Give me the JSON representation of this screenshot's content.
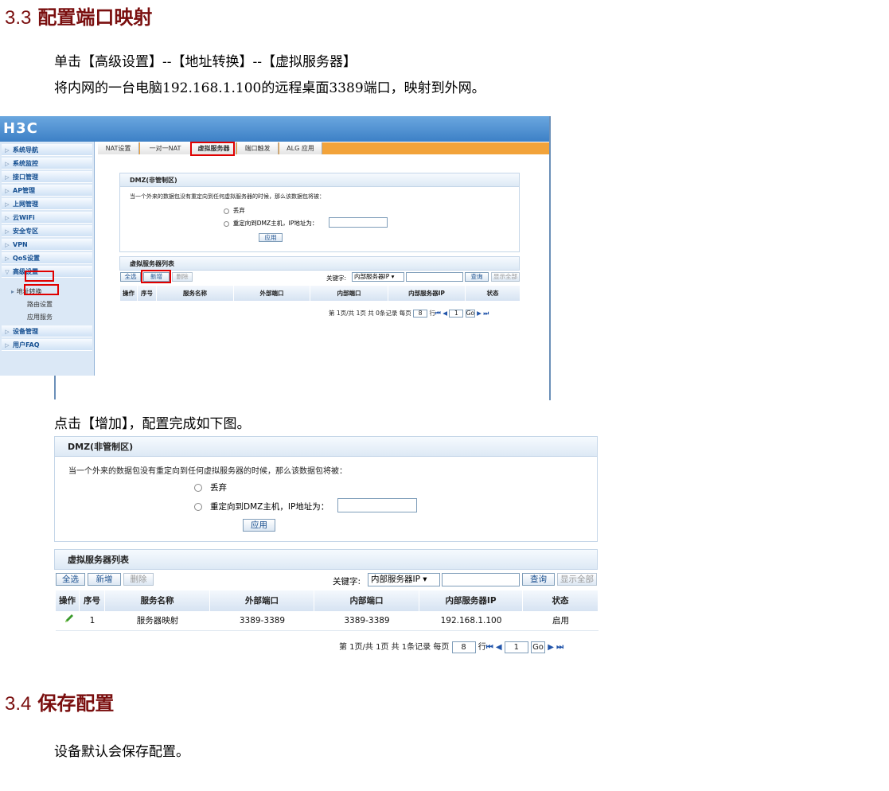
{
  "sections": [
    {
      "number": "3.3",
      "title": "配置端口映射"
    },
    {
      "number": "3.4",
      "title": "保存配置"
    }
  ],
  "paragraphs": {
    "nav_path": "单击【高级设置】--【地址转换】--【虚拟服务器】",
    "intro": "将内网的一台电脑192.168.1.100的远程桌面3389端口，映射到外网。",
    "click_add": "点击【增加】，配置完成如下图。",
    "save_default": "设备默认会保存配置。"
  },
  "router_ui": {
    "logo": "H3C",
    "sidebar": [
      "系统导航",
      "系统监控",
      "接口管理",
      "AP管理",
      "上网管理",
      "云WiFi",
      "安全专区",
      "VPN",
      "QoS设置",
      "高级设置",
      "设备管理",
      "用户FAQ"
    ],
    "sidebar_sub": [
      "地址转换",
      "路由设置",
      "应用服务"
    ],
    "tabs": [
      "NAT设置",
      "一对一NAT",
      "虚拟服务器",
      "端口触发",
      "ALG 应用"
    ],
    "dmz": {
      "title": "DMZ(非管制区)",
      "description": "当一个外来的数据包没有重定向到任何虚拟服务器的时候，那么该数据包将被：",
      "option_drop": "丢弃",
      "option_redirect": "重定向到DMZ主机，IP地址为：",
      "apply": "应用"
    },
    "vs_list": {
      "title": "虚拟服务器列表",
      "buttons": {
        "select_all": "全选",
        "add": "新增",
        "delete": "删除"
      },
      "keyword_label": "关键字:",
      "keyword_select": "内部服务器IP",
      "search": "查询",
      "show_all": "显示全部",
      "columns": [
        "操作",
        "序号",
        "服务名称",
        "外部端口",
        "内部端口",
        "内部服务器IP",
        "状态"
      ],
      "rows_shot1": [],
      "rows_shot2": [
        {
          "seq": "1",
          "name": "服务器映射",
          "ext_port": "3389-3389",
          "int_port": "3389-3389",
          "ip": "192.168.1.100",
          "status": "启用"
        }
      ],
      "pager_shot1": {
        "text": "第 1页/共 1页 共 0条记录 每页",
        "per_page": "8",
        "row_label": "行",
        "page": "1",
        "go": "Go"
      },
      "pager_shot2": {
        "text": "第 1页/共 1页 共 1条记录 每页",
        "per_page": "8",
        "row_label": "行",
        "page": "1",
        "go": "Go"
      }
    }
  },
  "colors": {
    "section_title": "#7a0f0f",
    "highlight_box": "#e00000",
    "tab_bar": "#f2a33a",
    "header_bar": "#3d80c6"
  }
}
